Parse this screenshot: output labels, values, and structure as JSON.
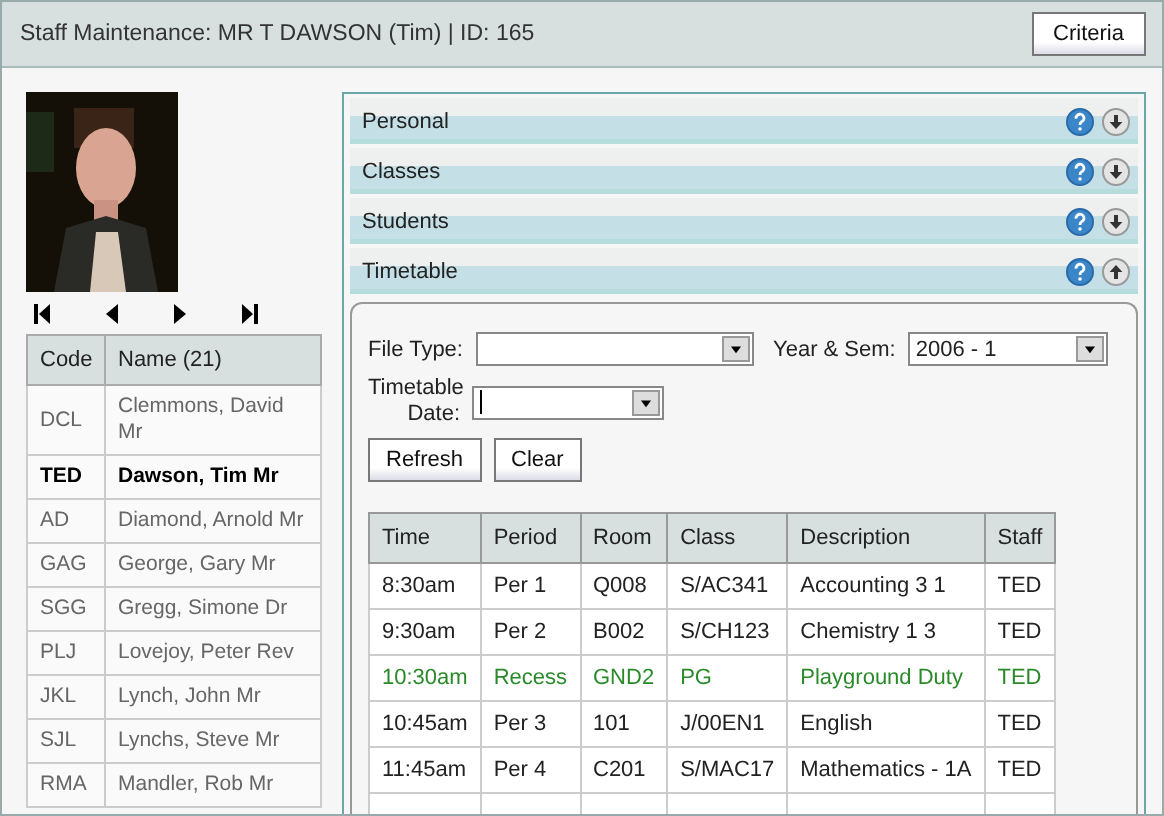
{
  "header": {
    "title": "Staff Maintenance: MR T DAWSON (Tim) | ID: 165",
    "criteria_button": "Criteria"
  },
  "staff_table": {
    "columns": [
      "Code",
      "Name (21)"
    ],
    "rows": [
      {
        "code": "DCL",
        "name": "Clemmons, David Mr",
        "selected": false
      },
      {
        "code": "TED",
        "name": "Dawson, Tim Mr",
        "selected": true
      },
      {
        "code": "AD",
        "name": "Diamond, Arnold Mr",
        "selected": false
      },
      {
        "code": "GAG",
        "name": "George, Gary Mr",
        "selected": false
      },
      {
        "code": "SGG",
        "name": "Gregg, Simone Dr",
        "selected": false
      },
      {
        "code": "PLJ",
        "name": "Lovejoy, Peter Rev",
        "selected": false
      },
      {
        "code": "JKL",
        "name": "Lynch, John Mr",
        "selected": false
      },
      {
        "code": "SJL",
        "name": "Lynchs, Steve Mr",
        "selected": false
      },
      {
        "code": "RMA",
        "name": "Mandler, Rob Mr",
        "selected": false
      }
    ]
  },
  "sections": [
    {
      "title": "Personal",
      "expanded": false
    },
    {
      "title": "Classes",
      "expanded": false
    },
    {
      "title": "Students",
      "expanded": false
    },
    {
      "title": "Timetable",
      "expanded": true
    }
  ],
  "form": {
    "file_type_label": "File Type:",
    "year_sem_label": "Year & Sem:",
    "year_sem_value": "2006 - 1",
    "date_label": "Timetable Date:",
    "buttons": [
      "Refresh",
      "Clear"
    ]
  },
  "timetable": {
    "columns": [
      "Time",
      "Period",
      "Room",
      "Class",
      "Description",
      "Staff"
    ],
    "rows": [
      {
        "kind": "class",
        "cells": [
          "8:30am",
          "Per 1",
          "Q008",
          "S/AC341",
          "Accounting 3 1",
          "TED"
        ]
      },
      {
        "kind": "class",
        "cells": [
          "9:30am",
          "Per 2",
          "B002",
          "S/CH123",
          "Chemistry 1 3",
          "TED"
        ]
      },
      {
        "kind": "duty",
        "cells": [
          "10:30am",
          "Recess",
          "GND2",
          "PG",
          "Playground Duty",
          "TED"
        ]
      },
      {
        "kind": "class",
        "cells": [
          "10:45am",
          "Per 3",
          "101",
          "J/00EN1",
          "English",
          "TED"
        ]
      },
      {
        "kind": "class",
        "cells": [
          "11:45am",
          "Per 4",
          "C201",
          "S/MAC17",
          "Mathematics - 1A",
          "TED"
        ]
      }
    ]
  }
}
